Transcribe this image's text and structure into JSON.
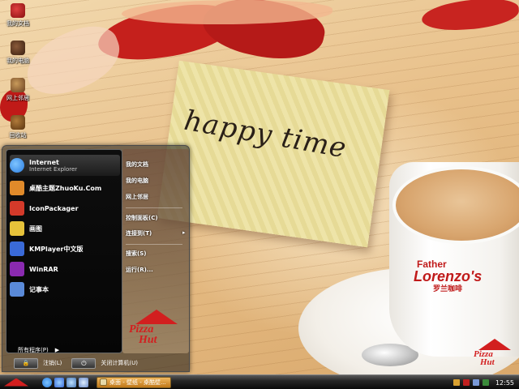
{
  "wallpaper": {
    "card_text": "happy time",
    "cup_brand": {
      "line1": "Father",
      "line2": "Lorenzo's",
      "line3": "罗兰咖啡"
    },
    "corner_logo": {
      "line1": "Pizza",
      "line2": "Hut"
    }
  },
  "desktop_icons": [
    {
      "label": "我的文档",
      "icon": "documents-icon"
    },
    {
      "label": "我的电脑",
      "icon": "computer-icon"
    },
    {
      "label": "网上邻居",
      "icon": "network-icon"
    },
    {
      "label": "回收站",
      "icon": "recycle-bin-icon"
    }
  ],
  "start_menu": {
    "pinned": [
      {
        "title": "Internet",
        "subtitle": "Internet Explorer",
        "icon": "internet-explorer-icon",
        "color": "#2a7de0"
      }
    ],
    "programs": [
      {
        "title": "桌酷主题ZhuoKu.Com",
        "icon": "zhuoku-icon",
        "color": "#e08a2a"
      },
      {
        "title": "IconPackager",
        "icon": "iconpackager-icon",
        "color": "#d33a2a"
      },
      {
        "title": "画图",
        "icon": "paint-icon",
        "color": "#e6c23a"
      },
      {
        "title": "KMPlayer中文版",
        "icon": "kmplayer-icon",
        "color": "#3a6ad8"
      },
      {
        "title": "WinRAR",
        "icon": "winrar-icon",
        "color": "#8a2ab0"
      },
      {
        "title": "记事本",
        "icon": "notepad-icon",
        "color": "#5a8ad8"
      }
    ],
    "all_programs": "所有程序(P)",
    "right_items": [
      {
        "label": "我的文档",
        "submenu": false
      },
      {
        "label": "我的电脑",
        "submenu": false
      },
      {
        "label": "网上邻居",
        "submenu": false
      },
      {
        "label": "控制面板(C)",
        "submenu": false
      },
      {
        "label": "连接到(T)",
        "submenu": true
      },
      {
        "label": "搜索(S)",
        "submenu": false
      },
      {
        "label": "运行(R)...",
        "submenu": false
      }
    ],
    "logo": {
      "line1": "Pizza",
      "line2": "Hut"
    },
    "logoff_label": "注销(L)",
    "shutdown_label": "关闭计算机(U)"
  },
  "taskbar": {
    "tasks": [
      {
        "label": "桌面 - 壁纸 - 桌酷壁..."
      }
    ],
    "clock": "12:55"
  },
  "colors": {
    "brand_red": "#d21f1f",
    "task_orange": "#e0a040"
  }
}
